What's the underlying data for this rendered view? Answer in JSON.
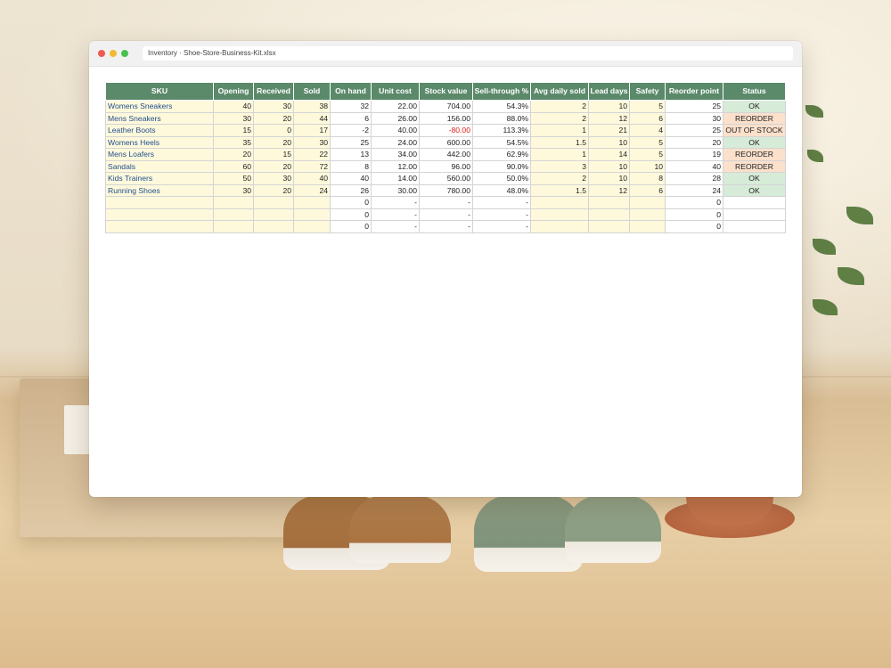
{
  "window": {
    "address": "Inventory · Shoe-Store-Business-Kit.xlsx"
  },
  "colors": {
    "header_bg": "#5b8a6b",
    "input_bg": "#fff9dc",
    "status_ok_bg": "#d6ebd8",
    "status_reorder_bg": "#fbe0cc",
    "negative_text": "#e0201b",
    "sku_text": "#1f4e8c"
  },
  "table": {
    "headers": [
      "SKU",
      "Opening",
      "Received",
      "Sold",
      "On hand",
      "Unit cost",
      "Stock value",
      "Sell-through %",
      "Avg daily sold",
      "Lead days",
      "Safety",
      "Reorder point",
      "Status"
    ],
    "rows": [
      [
        "Womens Sneakers",
        "40",
        "30",
        "38",
        "32",
        "22.00",
        "704.00",
        "54.3%",
        "2",
        "10",
        "5",
        "25",
        "OK"
      ],
      [
        "Mens Sneakers",
        "30",
        "20",
        "44",
        "6",
        "26.00",
        "156.00",
        "88.0%",
        "2",
        "12",
        "6",
        "30",
        "REORDER"
      ],
      [
        "Leather Boots",
        "15",
        "0",
        "17",
        "-2",
        "40.00",
        "-80.00",
        "113.3%",
        "1",
        "21",
        "4",
        "25",
        "OUT OF STOCK"
      ],
      [
        "Womens Heels",
        "35",
        "20",
        "30",
        "25",
        "24.00",
        "600.00",
        "54.5%",
        "1.5",
        "10",
        "5",
        "20",
        "OK"
      ],
      [
        "Mens Loafers",
        "20",
        "15",
        "22",
        "13",
        "34.00",
        "442.00",
        "62.9%",
        "1",
        "14",
        "5",
        "19",
        "REORDER"
      ],
      [
        "Sandals",
        "60",
        "20",
        "72",
        "8",
        "12.00",
        "96.00",
        "90.0%",
        "3",
        "10",
        "10",
        "40",
        "REORDER"
      ],
      [
        "Kids Trainers",
        "50",
        "30",
        "40",
        "40",
        "14.00",
        "560.00",
        "50.0%",
        "2",
        "10",
        "8",
        "28",
        "OK"
      ],
      [
        "Running Shoes",
        "30",
        "20",
        "24",
        "26",
        "30.00",
        "780.00",
        "48.0%",
        "1.5",
        "12",
        "6",
        "24",
        "OK"
      ],
      [
        "",
        "",
        "",
        "",
        "0",
        "-",
        "-",
        "-",
        "",
        "",
        "",
        "0",
        ""
      ],
      [
        "",
        "",
        "",
        "",
        "0",
        "-",
        "-",
        "-",
        "",
        "",
        "",
        "0",
        ""
      ],
      [
        "",
        "",
        "",
        "",
        "0",
        "-",
        "-",
        "-",
        "",
        "",
        "",
        "0",
        ""
      ]
    ]
  }
}
